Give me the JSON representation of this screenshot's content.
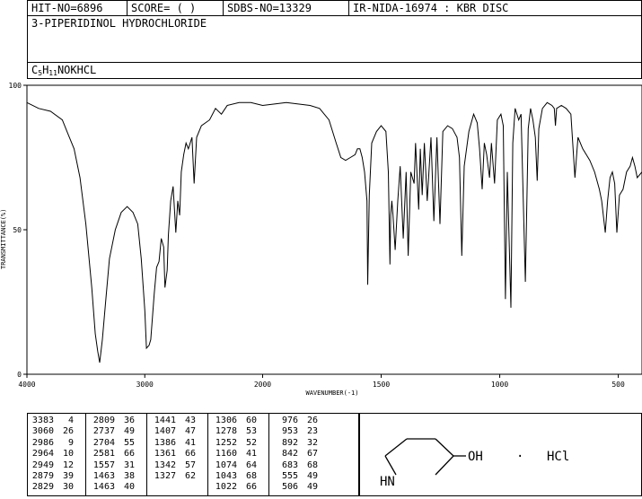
{
  "header": {
    "hit_no": "HIT-NO=6896",
    "score": "SCORE=  (   )",
    "sdbs_no": "SDBS-NO=13329",
    "ir_info": "IR-NIDA-16974 : KBR DISC"
  },
  "compound_name": "3-PIPERIDINOL HYDROCHLORIDE",
  "formula": {
    "c": "C",
    "c_n": "5",
    "h": "H",
    "h_n": "11",
    "rest": "NOKHCL"
  },
  "chart_data": {
    "type": "line",
    "xlabel": "WAVENUMBER(-1)",
    "ylabel": "TRANSMITTANCE(%)",
    "x_ticks": [
      "4000",
      "3000",
      "2000",
      "1500",
      "1000",
      "500"
    ],
    "y_ticks": [
      "100",
      "50",
      "0"
    ],
    "xlim": [
      4000,
      400
    ],
    "ylim": [
      0,
      100
    ],
    "x_scale": "piecewise: 4000-2000 and 2000-400 with doubled scale below 2000",
    "series": [
      {
        "points": [
          [
            4000,
            94
          ],
          [
            3900,
            92
          ],
          [
            3800,
            91
          ],
          [
            3700,
            88
          ],
          [
            3650,
            83
          ],
          [
            3600,
            78
          ],
          [
            3550,
            68
          ],
          [
            3500,
            52
          ],
          [
            3450,
            30
          ],
          [
            3420,
            14
          ],
          [
            3400,
            8
          ],
          [
            3383,
            4
          ],
          [
            3360,
            12
          ],
          [
            3330,
            26
          ],
          [
            3300,
            40
          ],
          [
            3250,
            50
          ],
          [
            3200,
            56
          ],
          [
            3150,
            58
          ],
          [
            3100,
            56
          ],
          [
            3060,
            52
          ],
          [
            3030,
            40
          ],
          [
            3000,
            22
          ],
          [
            2986,
            9
          ],
          [
            2964,
            10
          ],
          [
            2949,
            12
          ],
          [
            2920,
            28
          ],
          [
            2900,
            37
          ],
          [
            2879,
            39
          ],
          [
            2860,
            47
          ],
          [
            2840,
            44
          ],
          [
            2829,
            30
          ],
          [
            2810,
            36
          ],
          [
            2800,
            48
          ],
          [
            2780,
            60
          ],
          [
            2760,
            65
          ],
          [
            2737,
            49
          ],
          [
            2720,
            60
          ],
          [
            2704,
            55
          ],
          [
            2690,
            70
          ],
          [
            2670,
            76
          ],
          [
            2650,
            80
          ],
          [
            2630,
            78
          ],
          [
            2600,
            82
          ],
          [
            2581,
            66
          ],
          [
            2560,
            82
          ],
          [
            2520,
            86
          ],
          [
            2450,
            88
          ],
          [
            2400,
            92
          ],
          [
            2350,
            90
          ],
          [
            2300,
            93
          ],
          [
            2200,
            94
          ],
          [
            2100,
            94
          ],
          [
            2000,
            93
          ],
          [
            1950,
            93.5
          ],
          [
            1900,
            94
          ],
          [
            1850,
            93.5
          ],
          [
            1800,
            93
          ],
          [
            1760,
            92
          ],
          [
            1720,
            88
          ],
          [
            1690,
            80
          ],
          [
            1670,
            75
          ],
          [
            1650,
            74
          ],
          [
            1630,
            75
          ],
          [
            1610,
            76
          ],
          [
            1600,
            78
          ],
          [
            1590,
            78
          ],
          [
            1580,
            75
          ],
          [
            1570,
            70
          ],
          [
            1560,
            60
          ],
          [
            1557,
            31
          ],
          [
            1550,
            62
          ],
          [
            1540,
            80
          ],
          [
            1520,
            84
          ],
          [
            1500,
            86
          ],
          [
            1480,
            84
          ],
          [
            1470,
            70
          ],
          [
            1463,
            38
          ],
          [
            1460,
            55
          ],
          [
            1455,
            60
          ],
          [
            1450,
            55
          ],
          [
            1441,
            43
          ],
          [
            1430,
            60
          ],
          [
            1420,
            72
          ],
          [
            1407,
            47
          ],
          [
            1395,
            70
          ],
          [
            1386,
            41
          ],
          [
            1375,
            70
          ],
          [
            1361,
            66
          ],
          [
            1355,
            80
          ],
          [
            1342,
            57
          ],
          [
            1335,
            78
          ],
          [
            1327,
            62
          ],
          [
            1318,
            80
          ],
          [
            1306,
            60
          ],
          [
            1290,
            82
          ],
          [
            1278,
            53
          ],
          [
            1265,
            82
          ],
          [
            1252,
            52
          ],
          [
            1240,
            84
          ],
          [
            1220,
            86
          ],
          [
            1200,
            85
          ],
          [
            1180,
            82
          ],
          [
            1170,
            75
          ],
          [
            1160,
            41
          ],
          [
            1150,
            72
          ],
          [
            1130,
            84
          ],
          [
            1110,
            90
          ],
          [
            1095,
            87
          ],
          [
            1085,
            78
          ],
          [
            1074,
            64
          ],
          [
            1065,
            80
          ],
          [
            1055,
            76
          ],
          [
            1043,
            68
          ],
          [
            1035,
            80
          ],
          [
            1022,
            66
          ],
          [
            1010,
            88
          ],
          [
            995,
            90
          ],
          [
            985,
            86
          ],
          [
            976,
            26
          ],
          [
            968,
            70
          ],
          [
            953,
            23
          ],
          [
            945,
            80
          ],
          [
            935,
            92
          ],
          [
            920,
            88
          ],
          [
            910,
            90
          ],
          [
            892,
            32
          ],
          [
            880,
            85
          ],
          [
            870,
            92
          ],
          [
            860,
            88
          ],
          [
            850,
            82
          ],
          [
            842,
            67
          ],
          [
            835,
            85
          ],
          [
            820,
            92
          ],
          [
            800,
            94
          ],
          [
            780,
            93
          ],
          [
            770,
            92
          ],
          [
            765,
            86
          ],
          [
            760,
            92
          ],
          [
            740,
            93
          ],
          [
            720,
            92
          ],
          [
            700,
            90
          ],
          [
            683,
            68
          ],
          [
            670,
            82
          ],
          [
            650,
            78
          ],
          [
            620,
            74
          ],
          [
            600,
            70
          ],
          [
            580,
            64
          ],
          [
            570,
            60
          ],
          [
            555,
            49
          ],
          [
            545,
            60
          ],
          [
            535,
            68
          ],
          [
            525,
            70
          ],
          [
            515,
            66
          ],
          [
            506,
            49
          ],
          [
            495,
            62
          ],
          [
            480,
            64
          ],
          [
            465,
            70
          ],
          [
            450,
            72
          ],
          [
            440,
            75
          ],
          [
            430,
            72
          ],
          [
            420,
            68
          ],
          [
            400,
            70
          ]
        ]
      }
    ]
  },
  "peak_table": [
    [
      [
        "3383",
        "4"
      ],
      [
        "3060",
        "26"
      ],
      [
        "2986",
        "9"
      ],
      [
        "2964",
        "10"
      ],
      [
        "2949",
        "12"
      ],
      [
        "2879",
        "39"
      ],
      [
        "2829",
        "30"
      ]
    ],
    [
      [
        "2809",
        "36"
      ],
      [
        "2737",
        "49"
      ],
      [
        "2704",
        "55"
      ],
      [
        "2581",
        "66"
      ],
      [
        "1557",
        "31"
      ],
      [
        "1463",
        "38"
      ],
      [
        "1463",
        "40"
      ]
    ],
    [
      [
        "1441",
        "43"
      ],
      [
        "1407",
        "47"
      ],
      [
        "1386",
        "41"
      ],
      [
        "1361",
        "66"
      ],
      [
        "1342",
        "57"
      ],
      [
        "1327",
        "62"
      ]
    ],
    [
      [
        "1306",
        "60"
      ],
      [
        "1278",
        "53"
      ],
      [
        "1252",
        "52"
      ],
      [
        "1160",
        "41"
      ],
      [
        "1074",
        "64"
      ],
      [
        "1043",
        "68"
      ],
      [
        "1022",
        "66"
      ]
    ],
    [
      [
        "976",
        "26"
      ],
      [
        "953",
        "23"
      ],
      [
        "892",
        "32"
      ],
      [
        "842",
        "67"
      ],
      [
        "683",
        "68"
      ],
      [
        "555",
        "49"
      ],
      [
        "506",
        "49"
      ]
    ]
  ],
  "structure": {
    "nh_label": "HN",
    "oh_label": "OH",
    "dot": "·",
    "hcl_label": "HCl"
  }
}
